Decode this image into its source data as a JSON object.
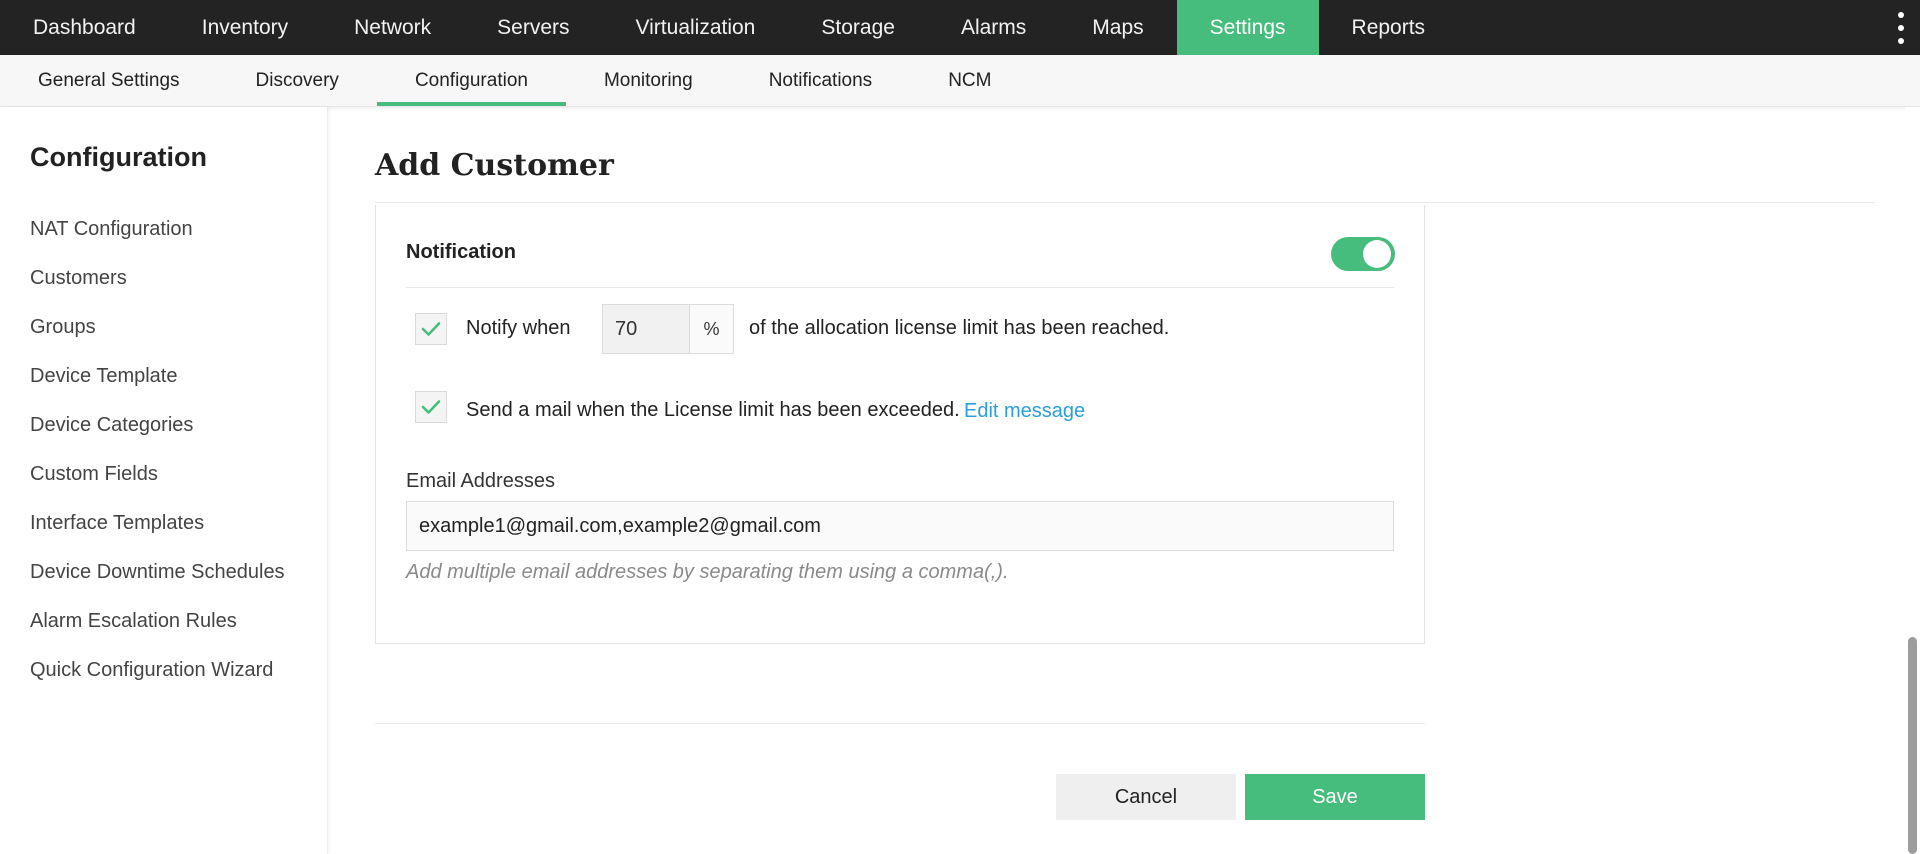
{
  "topnav": {
    "tabs": [
      {
        "label": "Dashboard"
      },
      {
        "label": "Inventory"
      },
      {
        "label": "Network"
      },
      {
        "label": "Servers"
      },
      {
        "label": "Virtualization"
      },
      {
        "label": "Storage"
      },
      {
        "label": "Alarms"
      },
      {
        "label": "Maps"
      },
      {
        "label": "Settings"
      },
      {
        "label": "Reports"
      }
    ],
    "active": "Settings",
    "accent_color": "#47bd7d"
  },
  "subnav": {
    "tabs": [
      {
        "label": "General Settings"
      },
      {
        "label": "Discovery"
      },
      {
        "label": "Configuration"
      },
      {
        "label": "Monitoring"
      },
      {
        "label": "Notifications"
      },
      {
        "label": "NCM"
      }
    ],
    "active": "Configuration"
  },
  "sidebar": {
    "title": "Configuration",
    "items": [
      {
        "label": "NAT Configuration"
      },
      {
        "label": "Customers"
      },
      {
        "label": "Groups"
      },
      {
        "label": "Device Template"
      },
      {
        "label": "Device Categories"
      },
      {
        "label": "Custom Fields"
      },
      {
        "label": "Interface Templates"
      },
      {
        "label": "Device Downtime Schedules"
      },
      {
        "label": "Alarm Escalation Rules"
      },
      {
        "label": "Quick Configuration Wizard"
      }
    ]
  },
  "main": {
    "title": "Add Customer",
    "notification": {
      "heading": "Notification",
      "toggle_on": true,
      "notify_checked": true,
      "notify_prefix": "Notify when",
      "percent_value": "70",
      "percent_symbol": "%",
      "notify_suffix": "of the allocation license limit has been reached.",
      "mail_checked": true,
      "mail_text": "Send a mail when the License limit has been exceeded.",
      "edit_message_link": "Edit message",
      "email_label": "Email Addresses",
      "email_value": "example1@gmail.com,example2@gmail.com",
      "email_hint": "Add multiple email addresses by separating them using a comma(,)."
    },
    "buttons": {
      "cancel_label": "Cancel",
      "save_label": "Save"
    }
  },
  "icons": {
    "checkmark": "check-icon",
    "more": "more-vertical-icon"
  }
}
